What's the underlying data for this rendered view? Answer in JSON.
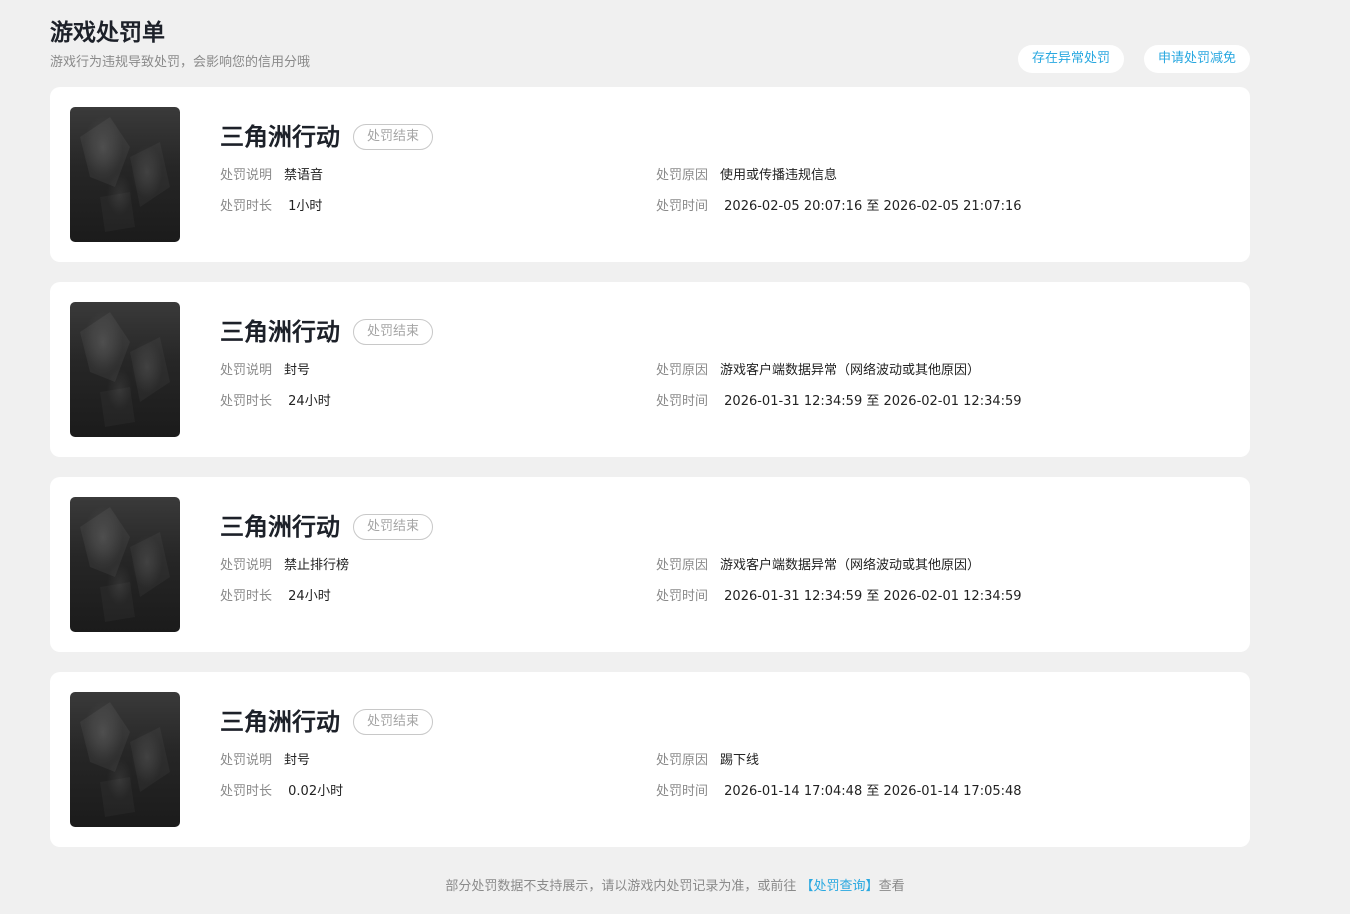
{
  "header": {
    "title": "游戏处罚单",
    "subtitle": "游戏行为违规导致处罚，会影响您的信用分哦",
    "actions": [
      "存在异常处罚",
      "申请处罚减免"
    ]
  },
  "labels": {
    "desc": "处罚说明",
    "reason": "处罚原因",
    "duration": "处罚时长",
    "time": "处罚时间"
  },
  "records": [
    {
      "game": "三角洲行动",
      "status": "处罚结束",
      "desc": "禁语音",
      "reason": "使用或传播违规信息",
      "duration": " 1小时",
      "time": " 2026-02-05 20:07:16 至 2026-02-05 21:07:16"
    },
    {
      "game": "三角洲行动",
      "status": "处罚结束",
      "desc": "封号",
      "reason": "游戏客户端数据异常（网络波动或其他原因）",
      "duration": " 24小时",
      "time": " 2026-01-31 12:34:59 至 2026-02-01 12:34:59"
    },
    {
      "game": "三角洲行动",
      "status": "处罚结束",
      "desc": "禁止排行榜",
      "reason": "游戏客户端数据异常（网络波动或其他原因）",
      "duration": " 24小时",
      "time": " 2026-01-31 12:34:59 至 2026-02-01 12:34:59"
    },
    {
      "game": "三角洲行动",
      "status": "处罚结束",
      "desc": "封号",
      "reason": "踢下线",
      "duration": " 0.02小时",
      "time": " 2026-01-14 17:04:48 至 2026-01-14 17:05:48"
    }
  ],
  "footer": {
    "text_before": "部分处罚数据不支持展示，请以游戏内处罚记录为准，或前往 ",
    "link": "【处罚查询】",
    "text_after": "查看"
  }
}
